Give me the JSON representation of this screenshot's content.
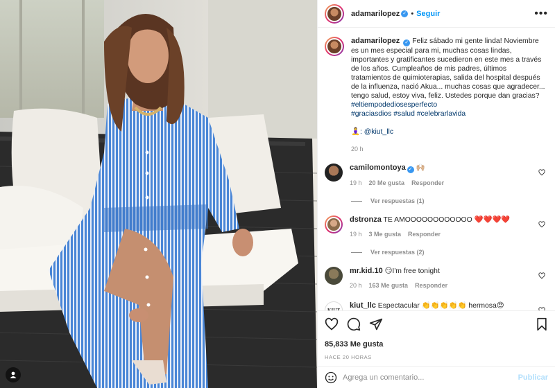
{
  "post": {
    "username": "adamarilopez",
    "follow_label": "Seguir",
    "caption": "Feliz sábado mi gente linda! Noviembre es un mes especial para mi, muchas cosas lindas, importantes y gratificantes sucedieron en este mes a través de los años. Cumpleaños de mis padres, últimos tratamientos de quimioterapias, salida del hospital después de la influenza, nació Akua... muchas cosas que agradecer... tengo salud, estoy viva, feliz. Ustedes porque dan gracias?",
    "hashtags_line1": "#eltiempodediosesperfecto",
    "hashtags_line2": "#graciasdios #salud #celebrarlavida",
    "mention": "🧘‍♀️: @kiut_llc",
    "caption_time": "20 h",
    "likes": "85,833 Me gusta",
    "time_ago": "HACE 20 HORAS"
  },
  "comments": [
    {
      "user": "camilomontoya",
      "text": "🙌🏼",
      "time": "19 h",
      "likes": "20 Me gusta",
      "reply": "Responder",
      "view_replies": "Ver respuestas (1)"
    },
    {
      "user": "dstronza",
      "text": "TE AMOOOOOOOOOOOO ❤️❤️❤️❤️",
      "time": "19 h",
      "likes": "3 Me gusta",
      "reply": "Responder",
      "view_replies": "Ver respuestas (2)"
    },
    {
      "user": "mr.kid.10",
      "text": "😏I'm free tonight",
      "time": "20 h",
      "likes": "163 Me gusta",
      "reply": "Responder"
    },
    {
      "user": "kiut_llc",
      "text": "Espectacular 👏👏👏👏👏 hermosa😍"
    }
  ],
  "composer": {
    "placeholder": "Agrega un comentario...",
    "post_label": "Publicar"
  },
  "icons": {
    "like": "heart-icon",
    "comment": "comment-icon",
    "share": "share-icon",
    "save": "bookmark-icon",
    "more": "more-icon",
    "emoji": "emoji-icon",
    "user_tag": "user-tag-icon"
  },
  "colors": {
    "link": "#0095f6",
    "hashtag": "#00376b",
    "muted": "#8e8e8e"
  }
}
